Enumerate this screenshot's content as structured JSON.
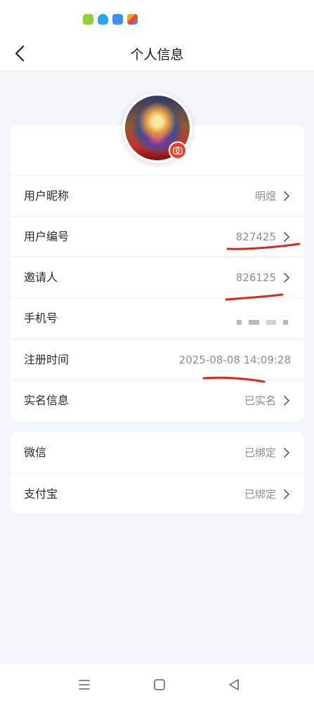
{
  "header": {
    "title": "个人信息"
  },
  "profile": {
    "rows": [
      {
        "label": "用户昵称",
        "value": "明煜"
      },
      {
        "label": "用户编号",
        "value": "827425"
      },
      {
        "label": "邀请人",
        "value": "826125"
      },
      {
        "label": "手机号",
        "value": ""
      },
      {
        "label": "注册时间",
        "value": "2025-08-08 14:09:28"
      },
      {
        "label": "实名信息",
        "value": "已实名"
      }
    ]
  },
  "bindings": {
    "rows": [
      {
        "label": "微信",
        "value": "已绑定"
      },
      {
        "label": "支付宝",
        "value": "已绑定"
      }
    ]
  },
  "colors": {
    "accent": "#ee3b24",
    "background": "#f4f5f9"
  }
}
